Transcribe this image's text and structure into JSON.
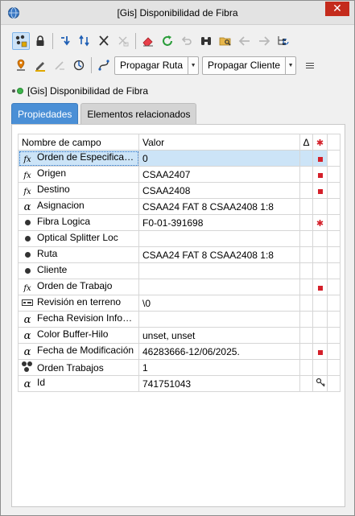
{
  "window": {
    "title": "[Gis] Disponibilidad de Fibra",
    "close_glyph": "✕"
  },
  "toolbar1": {
    "buttons": [
      "multi-select-icon",
      "lock-icon",
      "move-down-icon",
      "swap-icon",
      "cut-icon",
      "unlink-icon",
      "eraser-icon",
      "refresh-icon",
      "undo-icon",
      "binoculars-icon",
      "folder-search-icon",
      "back-arrow-icon",
      "forward-arrow-icon",
      "tree-refresh-icon"
    ]
  },
  "toolbar2": {
    "buttons": [
      "map-pin-icon",
      "pen-icon",
      "edit-disabled-icon",
      "target-icon",
      "route-curve-icon"
    ],
    "propagar_ruta": "Propagar Ruta",
    "propagar_cliente": "Propagar Cliente",
    "dropdown_glyph": "▼"
  },
  "object": {
    "label": "[Gis] Disponibilidad de Fibra"
  },
  "tabs": {
    "propiedades": "Propiedades",
    "elementos": "Elementos relacionados"
  },
  "grid": {
    "headers": {
      "nombre": "Nombre de campo",
      "valor": "Valor",
      "col3": "Δ",
      "col4": "✱"
    },
    "rows": [
      {
        "icon": "fx",
        "name": "Orden de Especificación",
        "value": "0",
        "flag": "square"
      },
      {
        "icon": "fx",
        "name": "Origen",
        "value": "CSAA2407",
        "flag": "square"
      },
      {
        "icon": "fx",
        "name": "Destino",
        "value": "CSAA2408",
        "flag": "square"
      },
      {
        "icon": "alpha",
        "name": "Asignacion",
        "value": "CSAA24 FAT 8 CSAA2408 1:8",
        "flag": ""
      },
      {
        "icon": "bullet",
        "name": "Fibra Logica",
        "value": "F0-01-391698",
        "flag": "star"
      },
      {
        "icon": "bullet",
        "name": "Optical Splitter Loc",
        "value": "",
        "flag": ""
      },
      {
        "icon": "bullet",
        "name": "Ruta",
        "value": "CSAA24 FAT 8 CSAA2408 1:8",
        "flag": ""
      },
      {
        "icon": "bullet",
        "name": "Cliente",
        "value": "",
        "flag": ""
      },
      {
        "icon": "fx",
        "name": "Orden de Trabajo",
        "value": "",
        "flag": "square"
      },
      {
        "icon": "box",
        "name": "Revisión en terreno",
        "value": "\\0",
        "flag": ""
      },
      {
        "icon": "alpha",
        "name": "Fecha Revision Infoware",
        "value": "",
        "flag": ""
      },
      {
        "icon": "alpha",
        "name": "Color Buffer-Hilo",
        "value": "unset, unset",
        "flag": ""
      },
      {
        "icon": "alpha",
        "name": "Fecha de Modificación",
        "value": "46283666-12/06/2025.",
        "flag": "square"
      },
      {
        "icon": "multi",
        "name": "Orden Trabajos",
        "value": "1",
        "flag": ""
      },
      {
        "icon": "alpha",
        "name": "Id",
        "value": "741751043",
        "flag": "key"
      }
    ]
  }
}
